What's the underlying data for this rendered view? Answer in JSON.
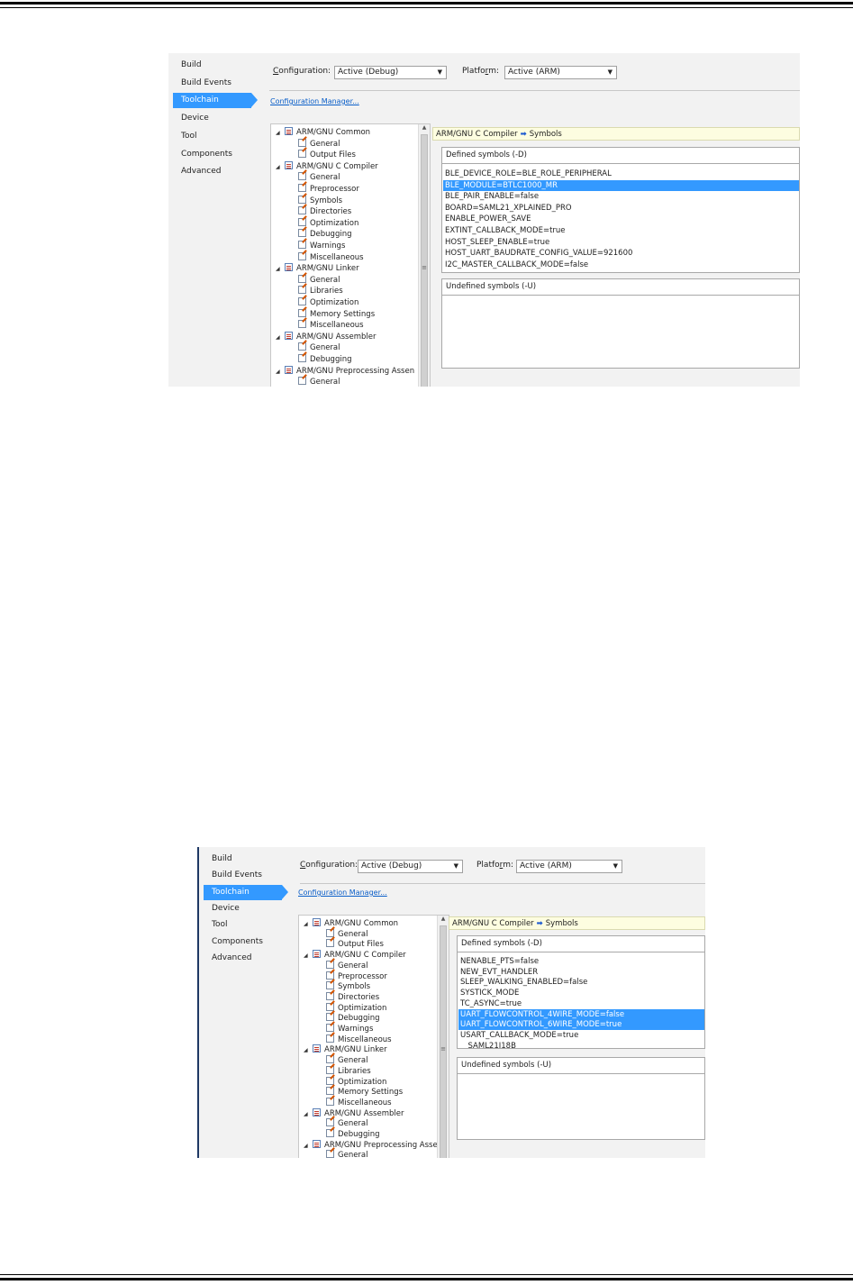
{
  "screens": [
    {
      "nav": [
        "Build",
        "Build Events",
        "Toolchain",
        "Device",
        "Tool",
        "Components",
        "Advanced"
      ],
      "active_nav": "Toolchain",
      "configuration_label": "Configuration:",
      "configuration_value": "Active (Debug)",
      "platform_label": "Platform:",
      "platform_value": "Active (ARM)",
      "config_manager_link": "Configuration Manager...",
      "tree": [
        {
          "label": "ARM/GNU Common",
          "level": 0
        },
        {
          "label": "General",
          "level": 1
        },
        {
          "label": "Output Files",
          "level": 1
        },
        {
          "label": "ARM/GNU C Compiler",
          "level": 0
        },
        {
          "label": "General",
          "level": 1
        },
        {
          "label": "Preprocessor",
          "level": 1
        },
        {
          "label": "Symbols",
          "level": 1
        },
        {
          "label": "Directories",
          "level": 1
        },
        {
          "label": "Optimization",
          "level": 1
        },
        {
          "label": "Debugging",
          "level": 1
        },
        {
          "label": "Warnings",
          "level": 1
        },
        {
          "label": "Miscellaneous",
          "level": 1
        },
        {
          "label": "ARM/GNU Linker",
          "level": 0
        },
        {
          "label": "General",
          "level": 1
        },
        {
          "label": "Libraries",
          "level": 1
        },
        {
          "label": "Optimization",
          "level": 1
        },
        {
          "label": "Memory Settings",
          "level": 1
        },
        {
          "label": "Miscellaneous",
          "level": 1
        },
        {
          "label": "ARM/GNU Assembler",
          "level": 0
        },
        {
          "label": "General",
          "level": 1
        },
        {
          "label": "Debugging",
          "level": 1
        },
        {
          "label": "ARM/GNU Preprocessing Assen",
          "level": 0
        },
        {
          "label": "General",
          "level": 1
        }
      ],
      "breadcrumb_left": "ARM/GNU C Compiler",
      "breadcrumb_right": "Symbols",
      "defined_header": "Defined symbols (-D)",
      "defined_symbols": [
        {
          "text": "BLE_DEVICE_ROLE=BLE_ROLE_PERIPHERAL",
          "selected": false
        },
        {
          "text": "BLE_MODULE=BTLC1000_MR",
          "selected": true
        },
        {
          "text": "BLE_PAIR_ENABLE=false",
          "selected": false
        },
        {
          "text": "BOARD=SAML21_XPLAINED_PRO",
          "selected": false
        },
        {
          "text": "ENABLE_POWER_SAVE",
          "selected": false
        },
        {
          "text": "EXTINT_CALLBACK_MODE=true",
          "selected": false
        },
        {
          "text": "HOST_SLEEP_ENABLE=true",
          "selected": false
        },
        {
          "text": "HOST_UART_BAUDRATE_CONFIG_VALUE=921600",
          "selected": false
        },
        {
          "text": "I2C_MASTER_CALLBACK_MODE=false",
          "selected": false
        }
      ],
      "undefined_header": "Undefined symbols (-U)",
      "undefined_symbols": []
    },
    {
      "nav": [
        "Build",
        "Build Events",
        "Toolchain",
        "Device",
        "Tool",
        "Components",
        "Advanced"
      ],
      "active_nav": "Toolchain",
      "configuration_label": "Configuration:",
      "configuration_value": "Active (Debug)",
      "platform_label": "Platform:",
      "platform_value": "Active (ARM)",
      "config_manager_link": "Configuration Manager...",
      "tree": [
        {
          "label": "ARM/GNU Common",
          "level": 0
        },
        {
          "label": "General",
          "level": 1
        },
        {
          "label": "Output Files",
          "level": 1
        },
        {
          "label": "ARM/GNU C Compiler",
          "level": 0
        },
        {
          "label": "General",
          "level": 1
        },
        {
          "label": "Preprocessor",
          "level": 1
        },
        {
          "label": "Symbols",
          "level": 1
        },
        {
          "label": "Directories",
          "level": 1
        },
        {
          "label": "Optimization",
          "level": 1
        },
        {
          "label": "Debugging",
          "level": 1
        },
        {
          "label": "Warnings",
          "level": 1
        },
        {
          "label": "Miscellaneous",
          "level": 1
        },
        {
          "label": "ARM/GNU Linker",
          "level": 0
        },
        {
          "label": "General",
          "level": 1
        },
        {
          "label": "Libraries",
          "level": 1
        },
        {
          "label": "Optimization",
          "level": 1
        },
        {
          "label": "Memory Settings",
          "level": 1
        },
        {
          "label": "Miscellaneous",
          "level": 1
        },
        {
          "label": "ARM/GNU Assembler",
          "level": 0
        },
        {
          "label": "General",
          "level": 1
        },
        {
          "label": "Debugging",
          "level": 1
        },
        {
          "label": "ARM/GNU Preprocessing Assen",
          "level": 0
        },
        {
          "label": "General",
          "level": 1
        }
      ],
      "breadcrumb_left": "ARM/GNU C Compiler",
      "breadcrumb_right": "Symbols",
      "defined_header": "Defined symbols (-D)",
      "defined_symbols": [
        {
          "text": "NENABLE_PTS=false",
          "selected": false
        },
        {
          "text": "NEW_EVT_HANDLER",
          "selected": false
        },
        {
          "text": "SLEEP_WALKING_ENABLED=false",
          "selected": false
        },
        {
          "text": "SYSTICK_MODE",
          "selected": false
        },
        {
          "text": "TC_ASYNC=true",
          "selected": false
        },
        {
          "text": "UART_FLOWCONTROL_4WIRE_MODE=false",
          "selected": true
        },
        {
          "text": "UART_FLOWCONTROL_6WIRE_MODE=true",
          "selected": true
        },
        {
          "text": "USART_CALLBACK_MODE=true",
          "selected": false
        },
        {
          "text": "__SAML21J18B__",
          "selected": false
        }
      ],
      "undefined_header": "Undefined symbols (-U)",
      "undefined_symbols": []
    }
  ],
  "colors": {
    "selection": "#3399ff",
    "breadcrumb_bg": "#fdfde0",
    "link": "#0a5ec8"
  }
}
